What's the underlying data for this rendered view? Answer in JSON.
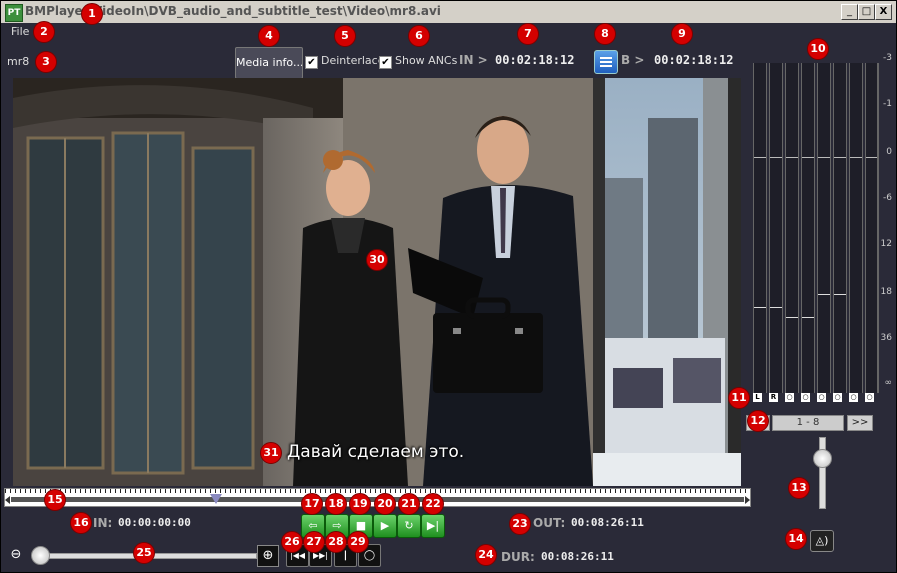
{
  "window": {
    "app_icon_text": "PT",
    "title": "BMPlayer",
    "path": "\\VideoIn\\DVB_audio_and_subtitle_test\\Video\\mr8.avi",
    "minimize": "_",
    "maximize": "□",
    "close": "X"
  },
  "menu": {
    "file": "File"
  },
  "toolbar": {
    "clip_name": "mr8",
    "media_info": "Media info...",
    "deinterlace": {
      "label": "Deinterlace",
      "checked": true
    },
    "show_ancs": {
      "label": "Show ANCs",
      "checked": true
    },
    "in_label": "IN >",
    "in_timecode": "00:02:18:12",
    "b_label": "B >",
    "b_timecode": "00:02:18:12"
  },
  "video": {
    "subtitle": "Давай сделаем это."
  },
  "audio_meter": {
    "db_ticks": [
      "-3",
      "-1",
      "0",
      "-6",
      "12",
      "18",
      "36",
      "∞"
    ],
    "channels": [
      {
        "tag": "L",
        "level": 0.74
      },
      {
        "tag": "R",
        "level": 0.74
      },
      {
        "tag": "○",
        "level": 0.77
      },
      {
        "tag": "○",
        "level": 0.77
      },
      {
        "tag": "○",
        "level": 0.7
      },
      {
        "tag": "○",
        "level": 0.7
      },
      {
        "tag": "○",
        "level": 0.0
      },
      {
        "tag": "○",
        "level": 0.0
      }
    ],
    "prev_page": "<<",
    "page_label": "1 - 8",
    "next_page": ">>"
  },
  "volume": {
    "level": 0.72
  },
  "timeline": {
    "position": 0.28
  },
  "timecodes": {
    "in_label": "IN:",
    "in_value": "00:00:00:00",
    "out_label": "OUT:",
    "out_value": "00:08:26:11",
    "dur_label": "DUR:",
    "dur_value": "00:08:26:11"
  },
  "transport": {
    "set_in": "⇦",
    "set_out": "⇨",
    "stop": "■",
    "play": "▶",
    "loop": "↻",
    "go_end": "▶|",
    "go_start": "|◀◀",
    "skip_fwd": "▶▶|",
    "mark": "|",
    "record": "◯"
  },
  "zoom": {
    "out_icon": "⊖",
    "in_icon": "⊕",
    "level": 0.0
  },
  "annotations": [
    "1",
    "2",
    "3",
    "4",
    "5",
    "6",
    "7",
    "8",
    "9",
    "10",
    "11",
    "12",
    "13",
    "14",
    "15",
    "16",
    "17",
    "18",
    "19",
    "20",
    "21",
    "22",
    "23",
    "24",
    "25",
    "26",
    "27",
    "28",
    "29",
    "30",
    "31"
  ]
}
